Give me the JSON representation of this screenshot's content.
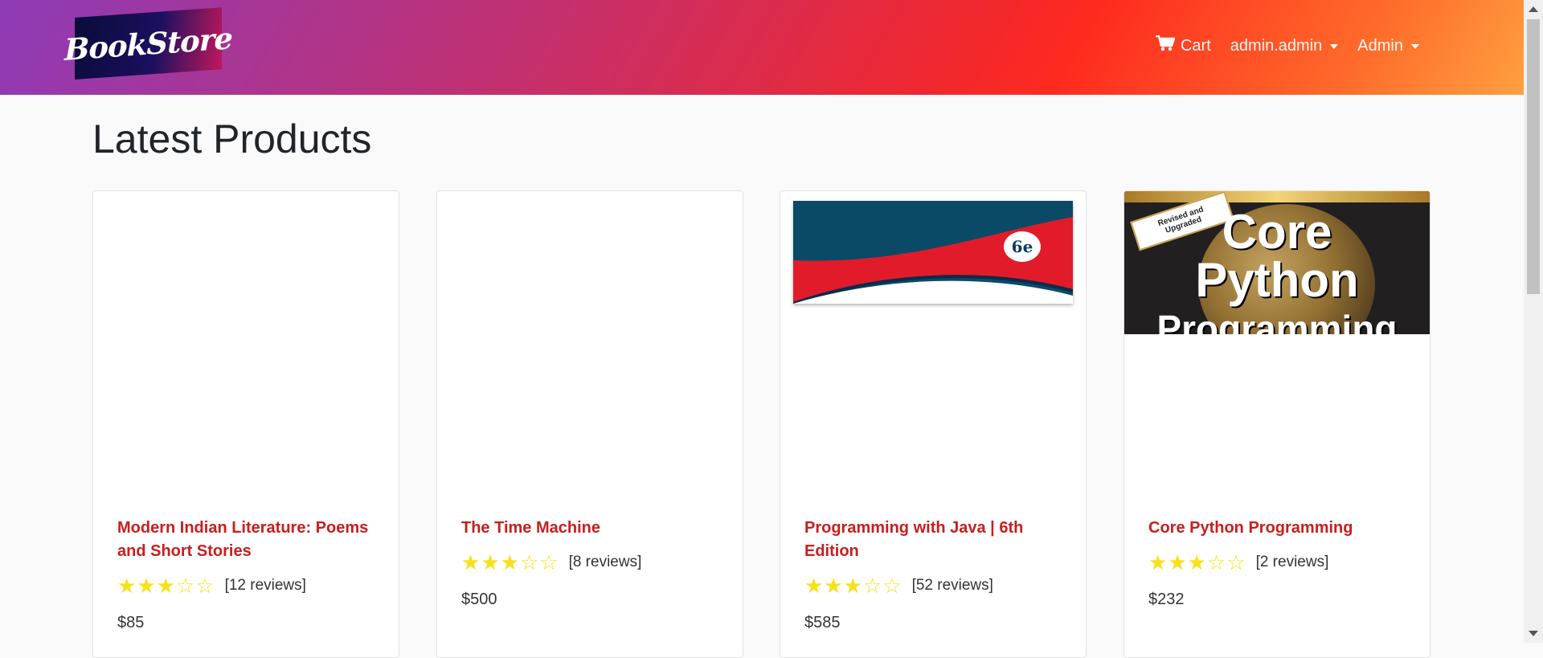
{
  "navbar": {
    "logo_text": "BookStore",
    "cart_label": "Cart",
    "user_label": "admin.admin",
    "admin_label": "Admin"
  },
  "page": {
    "title": "Latest Products"
  },
  "products": [
    {
      "title": "Modern Indian Literature: Poems and Short Stories",
      "rating": 3,
      "reviews": "[12 reviews]",
      "price": "$85"
    },
    {
      "title": "The Time Machine",
      "rating": 3,
      "reviews": "[8 reviews]",
      "price": "$500"
    },
    {
      "title": "Programming with Java | 6th Edition",
      "rating": 3,
      "reviews": "[52 reviews]",
      "price": "$585"
    },
    {
      "title": "Core Python Programming",
      "rating": 3,
      "reviews": "[2 reviews]",
      "price": "$232"
    }
  ],
  "covers": {
    "java_badge": "6e",
    "python_ribbon_1": "Revised and",
    "python_ribbon_2": "Upgraded",
    "python_line1": "Core",
    "python_line2": "Python",
    "python_line3": "Programming"
  },
  "colors": {
    "accent": "#c81e1e",
    "star": "#f8e01b"
  },
  "icons": {
    "cart": "cart-icon",
    "star_full": "star-filled-icon",
    "star_empty": "star-outline-icon"
  }
}
